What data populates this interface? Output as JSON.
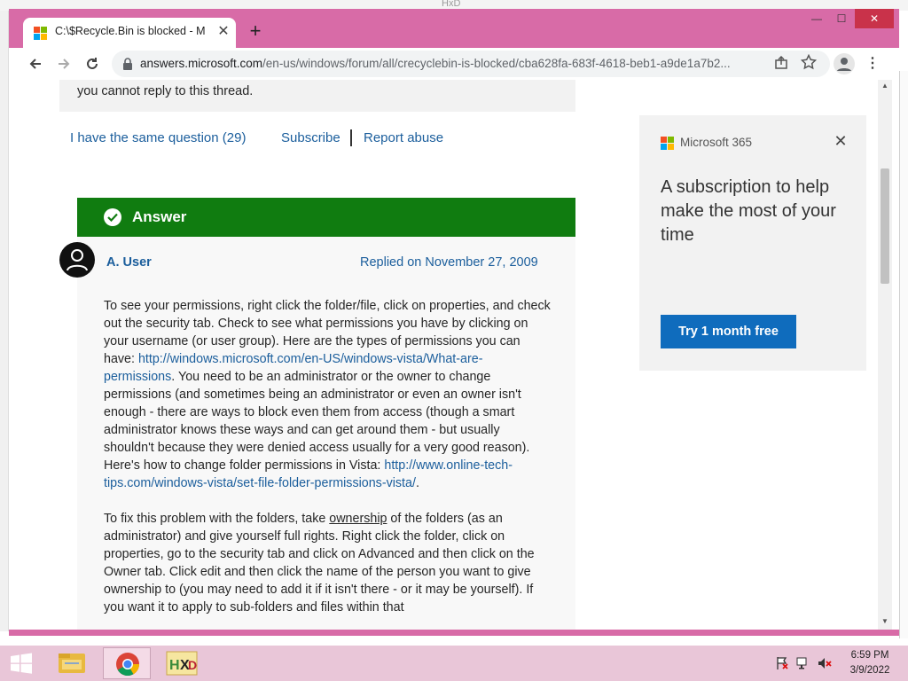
{
  "background_window": {
    "title": "HxD"
  },
  "browser": {
    "tab": {
      "title": "C:\\$Recycle.Bin is blocked - Micr",
      "close": "✕"
    },
    "new_tab": "+",
    "window_controls": {
      "minimize": "—",
      "maximize": "☐",
      "close": "✕"
    },
    "url_host": "answers.microsoft.com",
    "url_path": "/en-us/windows/forum/all/crecyclebin-is-blocked/cba628fa-683f-4618-beb1-a9de1a7b2...",
    "menu": "⋮"
  },
  "thread": {
    "notice": "you cannot reply to this thread.",
    "same_question": "I have the same question (29)",
    "subscribe": "Subscribe",
    "report_abuse": "Report abuse"
  },
  "answer": {
    "label": "Answer",
    "author": "A. User",
    "replied": "Replied on November 27, 2009",
    "p1_a": "To see your permissions, right click the folder/file, click on properties, and check out the security tab.  Check to see what permissions you have by clicking on your username (or user group).  Here are the types of permissions you can have: ",
    "p1_link1": "http://windows.microsoft.com/en-US/windows-vista/What-are-permissions",
    "p1_b": ".  You need to be an administrator or the owner to change permissions (and sometimes being an administrator or even an owner isn't enough - there are ways to block even them from access (though a smart administrator knows these ways and can get around them - but usually shouldn't because they were denied access usually for a very good reason).  Here's how to change folder permissions in Vista: ",
    "p1_link2": "http://www.online-tech-tips.com/windows-vista/set-file-folder-permissions-vista/",
    "p1_c": ".",
    "p2_a": "To fix this problem with the folders, take ",
    "p2_ownership": "ownership",
    "p2_b": " of the folders (as an administrator) and give yourself full rights.  Right click the folder, click on properties, go to the security tab and click on Advanced and then click on the Owner tab.  Click edit and then click the name of the person you want to give ownership to (you may need to add it if it isn't there - or it may be yourself).  If you want it to apply to sub-folders and files within that"
  },
  "ad": {
    "brand": "Microsoft 365",
    "close": "✕",
    "headline": "A subscription to help make the most of your time",
    "cta": "Try 1 month free"
  },
  "taskbar": {
    "time": "6:59 PM",
    "date": "3/9/2022"
  },
  "colors": {
    "chrome_frame": "#d86ba7",
    "link": "#1b5e9c",
    "answer_green": "#107c10",
    "cta_blue": "#0f6cbd",
    "taskbar": "#e9c6d8"
  }
}
